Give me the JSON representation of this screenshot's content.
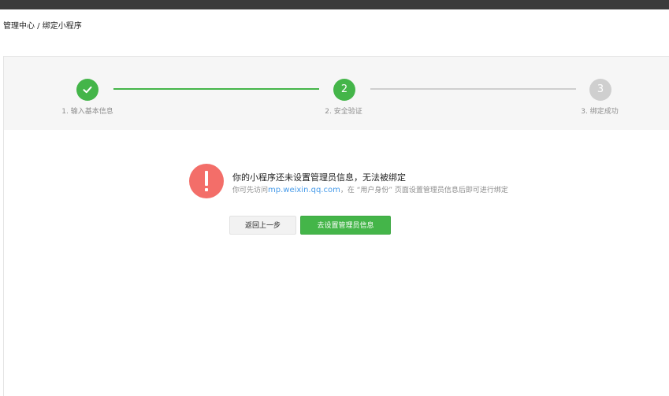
{
  "breadcrumb": {
    "root": "管理中心",
    "separator": " / ",
    "current": "绑定小程序"
  },
  "steps": [
    {
      "number": "1",
      "label": "1. 输入基本信息",
      "state": "done",
      "icon": "check-icon"
    },
    {
      "number": "2",
      "label": "2. 安全验证",
      "state": "active"
    },
    {
      "number": "3",
      "label": "3. 绑定成功",
      "state": "todo"
    }
  ],
  "message": {
    "icon": "exclamation-icon",
    "title": "你的小程序还未设置管理员信息，无法被绑定",
    "desc_prefix": "你可先访问",
    "desc_link": "mp.weixin.qq.com",
    "desc_suffix": "，在 “用户身份” 页面设置管理员信息后即可进行绑定"
  },
  "buttons": {
    "back_label": "返回上一步",
    "go_label": "去设置管理员信息"
  },
  "colors": {
    "accent": "#44b549",
    "warning": "#f36e69",
    "link": "#459ae9",
    "inactive": "#cfcfcf"
  }
}
